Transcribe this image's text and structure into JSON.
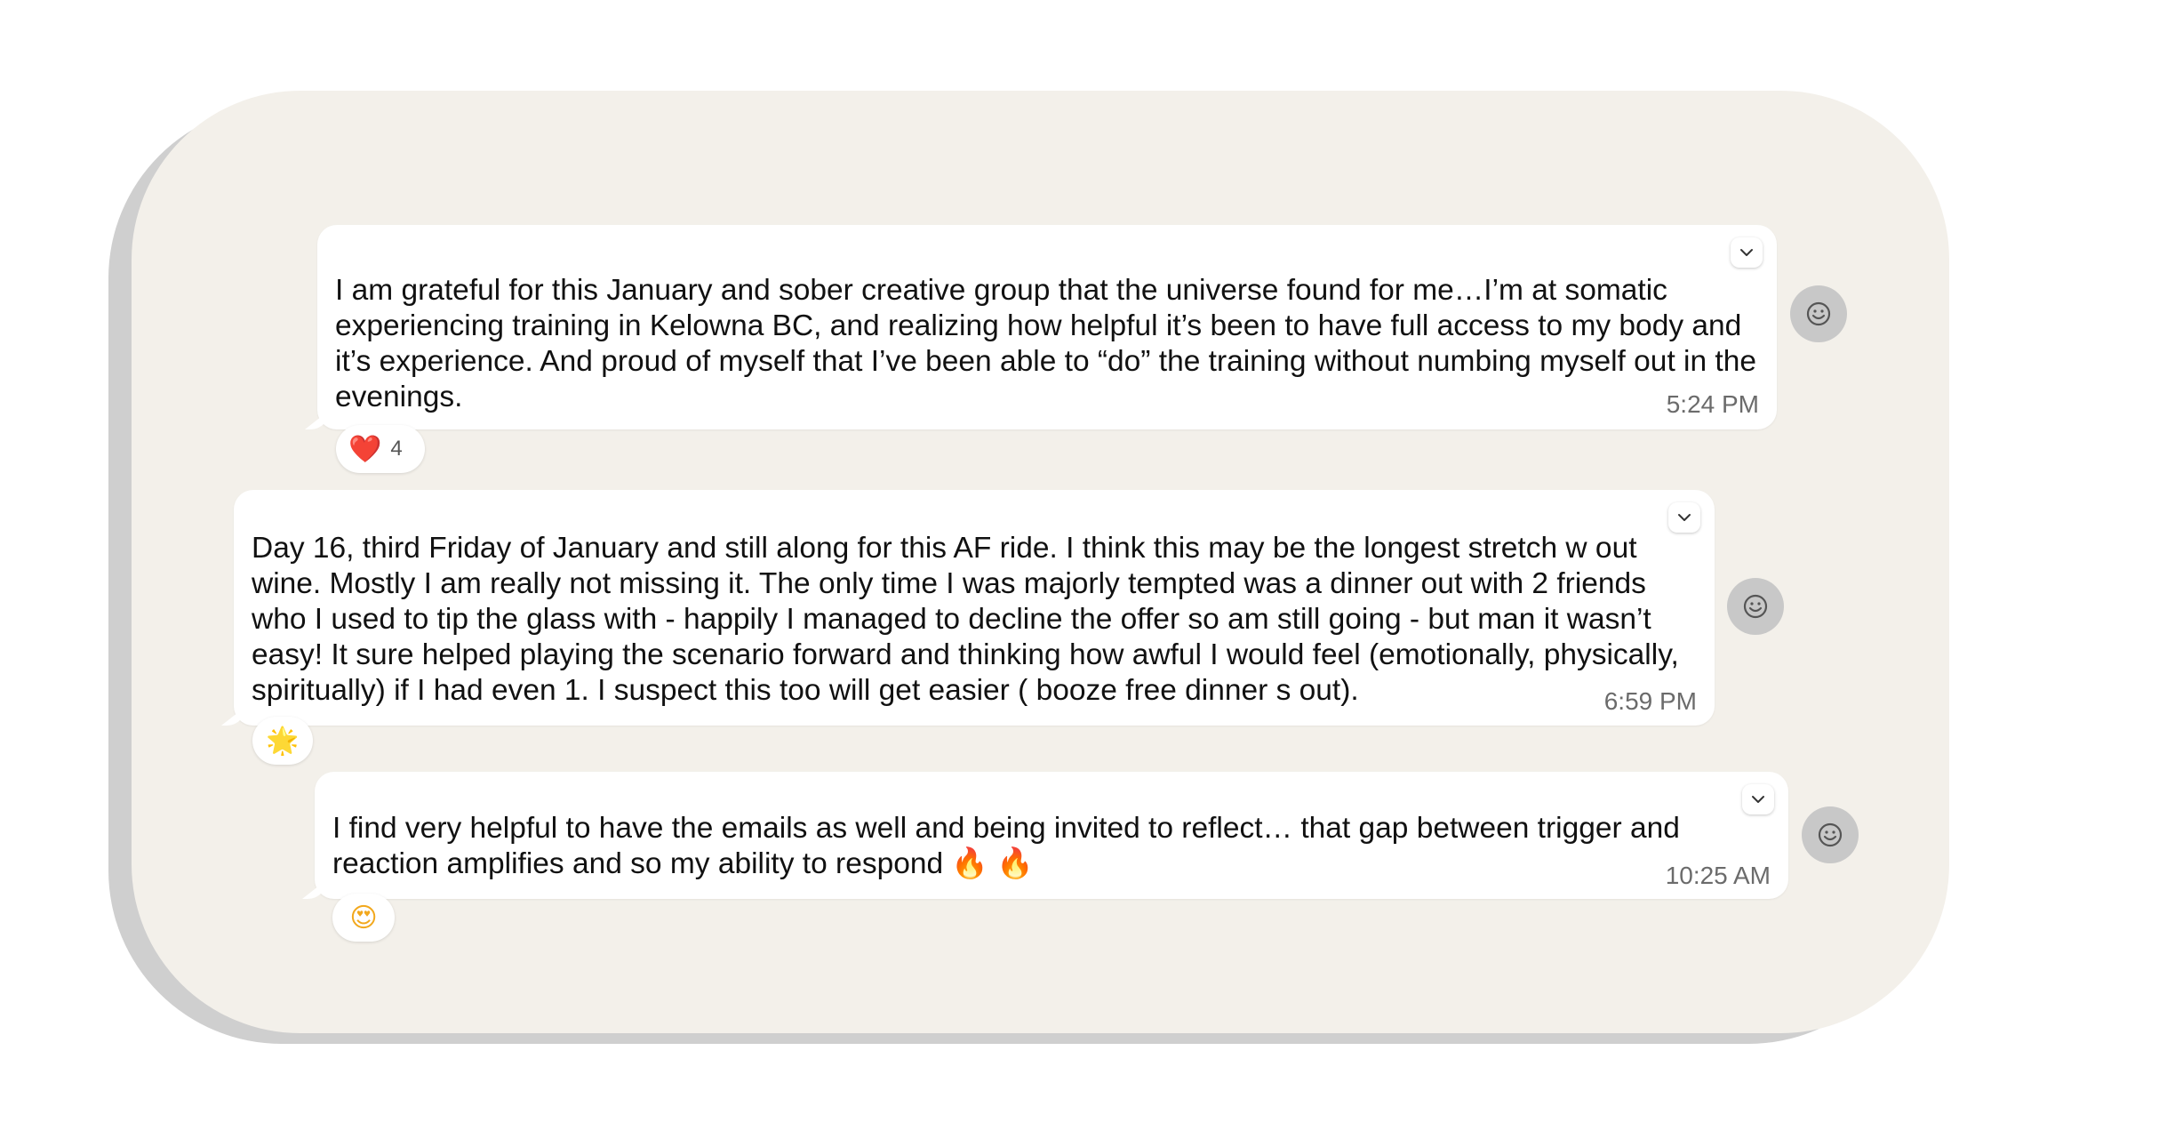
{
  "messages": [
    {
      "text": "I am grateful for this January and sober creative group that the universe found for me…I’m at somatic experiencing training in Kelowna BC, and realizing how helpful it’s been to have full access to my body and it’s experience. And proud of myself that I’ve been able to “do” the training without numbing myself out in the evenings.",
      "time": "5:24 PM",
      "reaction": {
        "emoji": "❤️",
        "count": "4"
      }
    },
    {
      "text": "Day 16, third Friday of January and still along for this AF ride. I think this may be the longest stretch w out wine. Mostly I am really not missing it. The only time I was majorly tempted was a dinner out with 2 friends who I used to tip the glass with - happily I managed to decline the offer so am still going - but man it wasn’t easy! It sure helped playing the scenario forward and thinking how awful I would feel (emotionally, physically, spiritually) if I had even 1. I suspect this too will get easier ( booze free dinner s out).",
      "time": "6:59 PM",
      "reaction": {
        "emoji": "🌟",
        "count": ""
      }
    },
    {
      "text": "I find very helpful to have the emails as well and being invited to reflect… that gap between trigger and reaction amplifies and so my ability to respond 🔥 🔥",
      "time": "10:25 AM",
      "reaction": {
        "emoji": "😍",
        "count": ""
      }
    }
  ],
  "icons": {
    "more_options": "chevron-down-icon",
    "add_reaction": "smiley-icon"
  },
  "colors": {
    "card_background": "#f3f0ea",
    "bubble_background": "#ffffff",
    "reaction_button": "#c8c8c8",
    "timestamp": "#6b6b6b"
  }
}
